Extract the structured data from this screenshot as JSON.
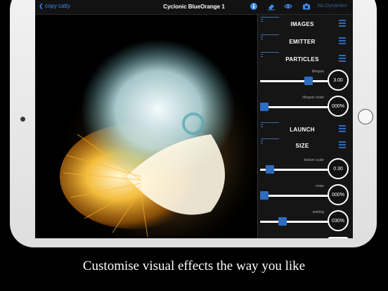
{
  "nav": {
    "back_label": "copy catty",
    "title": "Cyclonic BlueOrange 1",
    "dimmed_label": "No Dynamics",
    "accent_color": "#3b8ff0",
    "icons": [
      "info-icon",
      "eraser-icon",
      "eye-icon",
      "camera-icon"
    ]
  },
  "panel": {
    "sections": {
      "images": "IMAGES",
      "emitter": "EMITTER",
      "particles": "PARTICLES",
      "launch": "LAUNCH",
      "size": "SIZE"
    },
    "params": {
      "lifespan": {
        "label": "lifespan",
        "value": "3.00",
        "level": 0.71
      },
      "lifespan_noise": {
        "label": "lifespan noise",
        "value": "000%",
        "level": 0.06
      },
      "texture_scale": {
        "label": "texture scale",
        "value": "0.30",
        "level": 0.14
      },
      "noise": {
        "label": "noise",
        "value": "000%",
        "level": 0.06
      },
      "starting": {
        "label": "starting",
        "value": "030%",
        "level": 0.33
      }
    }
  },
  "caption": "Customise visual effects the way you like"
}
